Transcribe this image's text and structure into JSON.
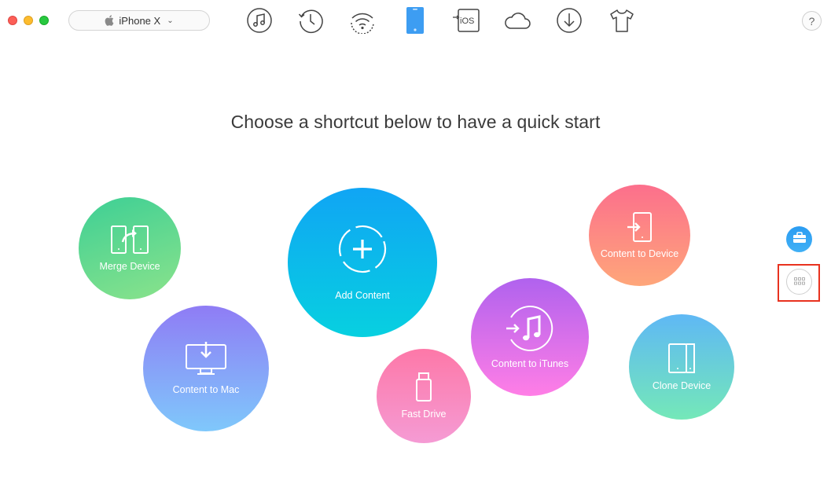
{
  "window": {
    "traffic_lights": [
      "close",
      "minimize",
      "maximize"
    ]
  },
  "device": {
    "name": "iPhone X",
    "icon": "apple-icon"
  },
  "toolbar": {
    "icons": [
      "music-icon",
      "history-icon",
      "wifi-sync-icon",
      "iphone-icon",
      "to-ios-icon",
      "icloud-icon",
      "download-icon",
      "tshirt-icon"
    ],
    "to_ios_text": "iOS",
    "help_label": "?"
  },
  "main": {
    "heading": "Choose a shortcut below to have a quick start",
    "shortcuts": [
      {
        "label": "Merge Device",
        "icon": "merge-device-icon"
      },
      {
        "label": "Content to Mac",
        "icon": "content-to-mac-icon"
      },
      {
        "label": "Add Content",
        "icon": "add-content-icon"
      },
      {
        "label": "Fast Drive",
        "icon": "fast-drive-icon"
      },
      {
        "label": "Content to iTunes",
        "icon": "content-to-itunes-icon"
      },
      {
        "label": "Content to Device",
        "icon": "content-to-device-icon"
      },
      {
        "label": "Clone Device",
        "icon": "clone-device-icon"
      }
    ]
  },
  "side_panel": {
    "icons": [
      "toolbox-icon",
      "grid-icon"
    ],
    "highlighted": "grid-icon"
  },
  "colors": {
    "accent": "#1aa3f5",
    "highlight": "#e8321f"
  }
}
